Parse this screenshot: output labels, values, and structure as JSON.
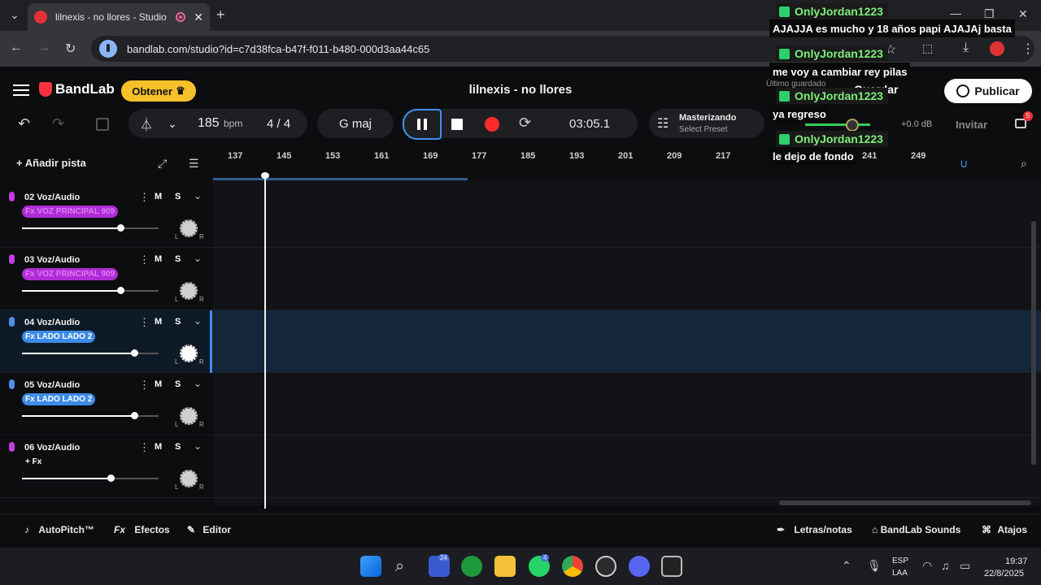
{
  "browser": {
    "tab_title": "lilnexis - no llores - Studio",
    "url": "bandlab.com/studio?id=c7d38fca-b47f-f011-b480-000d3aa44c65"
  },
  "header": {
    "logo": "BandLab",
    "obtener_label": "Obtener",
    "project_title": "lilnexis - no llores",
    "last_saved": "Último guardado",
    "save_label": "Guardar",
    "publish_label": "Publicar"
  },
  "transport": {
    "bpm_value": "185",
    "bpm_unit": "bpm",
    "time_signature": "4 / 4",
    "key": "G maj",
    "time": "03:05.1",
    "mastering_title": "Masterizando",
    "mastering_preset": "Select Preset",
    "master_db": "+0.0 dB",
    "invite_label": "Invitar",
    "notif_count": "5"
  },
  "tracks_header": {
    "add_track_label": "Añadir pista"
  },
  "tracks": [
    {
      "name": "02 Voz/Audio",
      "fx": "Fx VOZ PRINCIPAL 909",
      "fx_color": "#b12bd6",
      "mic_color": "#c23ee0",
      "volume": 0.72,
      "selected": false
    },
    {
      "name": "03 Voz/Audio",
      "fx": "Fx VOZ PRINCIPAL 909",
      "fx_color": "#b12bd6",
      "mic_color": "#c23ee0",
      "volume": 0.72,
      "selected": false
    },
    {
      "name": "04 Voz/Audio",
      "fx": "Fx LADO LADO 2",
      "fx_color": "#3d8be8",
      "mic_color": "#4d8fe8",
      "volume": 0.82,
      "selected": true
    },
    {
      "name": "05 Voz/Audio",
      "fx": "Fx LADO LADO 2",
      "fx_color": "#3d8be8",
      "mic_color": "#4d8fe8",
      "volume": 0.82,
      "selected": false
    },
    {
      "name": "06 Voz/Audio",
      "fx": "+ Fx",
      "fx_color": "transparent",
      "mic_color": "#c23ee0",
      "volume": 0.65,
      "selected": false
    }
  ],
  "track_controls": {
    "mute": "M",
    "solo": "S",
    "pan_left": "L",
    "pan_right": "R"
  },
  "ruler": [
    "137",
    "145",
    "153",
    "161",
    "169",
    "177",
    "185",
    "193",
    "201",
    "209",
    "217",
    "241",
    "249"
  ],
  "bottombar": {
    "autopitch": "AutoPitch™",
    "efectos": "Efectos",
    "editor": "Editor",
    "letras": "Letras/notas",
    "sounds": "BandLab Sounds",
    "atajos": "Atajos"
  },
  "taskbar": {
    "lang_top": "ESP",
    "lang_bottom": "LAA",
    "time": "19:37",
    "date": "22/8/2025",
    "badge_teams": "24",
    "badge_whatsapp": "4"
  },
  "chat": [
    {
      "user": "OnlyJordan1223",
      "msg": "AJAJJA es mucho y 18 años papi AJAJAj basta"
    },
    {
      "user": "OnlyJordan1223",
      "msg": "me voy a cambiar rey pilas"
    },
    {
      "user": "OnlyJordan1223",
      "msg": "ya regreso"
    },
    {
      "user": "OnlyJordan1223",
      "msg": "le dejo de fondo"
    }
  ]
}
